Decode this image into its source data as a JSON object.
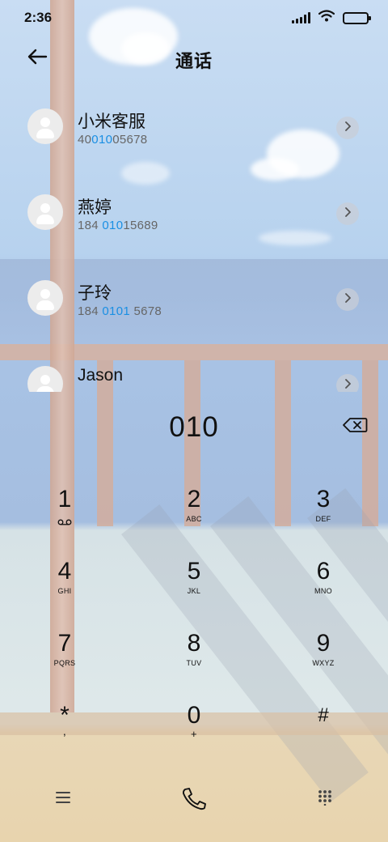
{
  "status_bar": {
    "time": "2:36",
    "icons": [
      "signal-icon",
      "wifi-icon",
      "battery-icon"
    ],
    "battery_level": 1.0
  },
  "header": {
    "back_icon": "arrow-left-icon",
    "title": "通话"
  },
  "contacts": [
    {
      "name": "小米客服",
      "number_before": "40",
      "number_match": "010",
      "number_after": "05678"
    },
    {
      "name": "燕婷",
      "number_before": "184 ",
      "number_match": "010",
      "number_after": "15689"
    },
    {
      "name": "子玲",
      "number_before": "184 ",
      "number_match": "0101",
      "number_after": " 5678"
    },
    {
      "name": "Jason",
      "number_before": "",
      "number_match": "",
      "number_after": ""
    }
  ],
  "dial": {
    "input": "010",
    "backspace_icon": "backspace-icon"
  },
  "keypad": [
    {
      "digit": "1",
      "letters": "",
      "icon": "voicemail-icon"
    },
    {
      "digit": "2",
      "letters": "ABC"
    },
    {
      "digit": "3",
      "letters": "DEF"
    },
    {
      "digit": "4",
      "letters": "GHI"
    },
    {
      "digit": "5",
      "letters": "JKL"
    },
    {
      "digit": "6",
      "letters": "MNO"
    },
    {
      "digit": "7",
      "letters": "PQRS"
    },
    {
      "digit": "8",
      "letters": "TUV"
    },
    {
      "digit": "9",
      "letters": "WXYZ"
    },
    {
      "digit": "*",
      "letters": ","
    },
    {
      "digit": "0",
      "letters": "+"
    },
    {
      "digit": "#",
      "letters": ""
    }
  ],
  "bottom_bar": {
    "menu_icon": "menu-icon",
    "call_icon": "phone-icon",
    "dialpad_icon": "dialpad-icon"
  },
  "colors": {
    "match_highlight": "#1a8fe3",
    "text_primary": "#111111",
    "text_secondary": "#666666"
  }
}
